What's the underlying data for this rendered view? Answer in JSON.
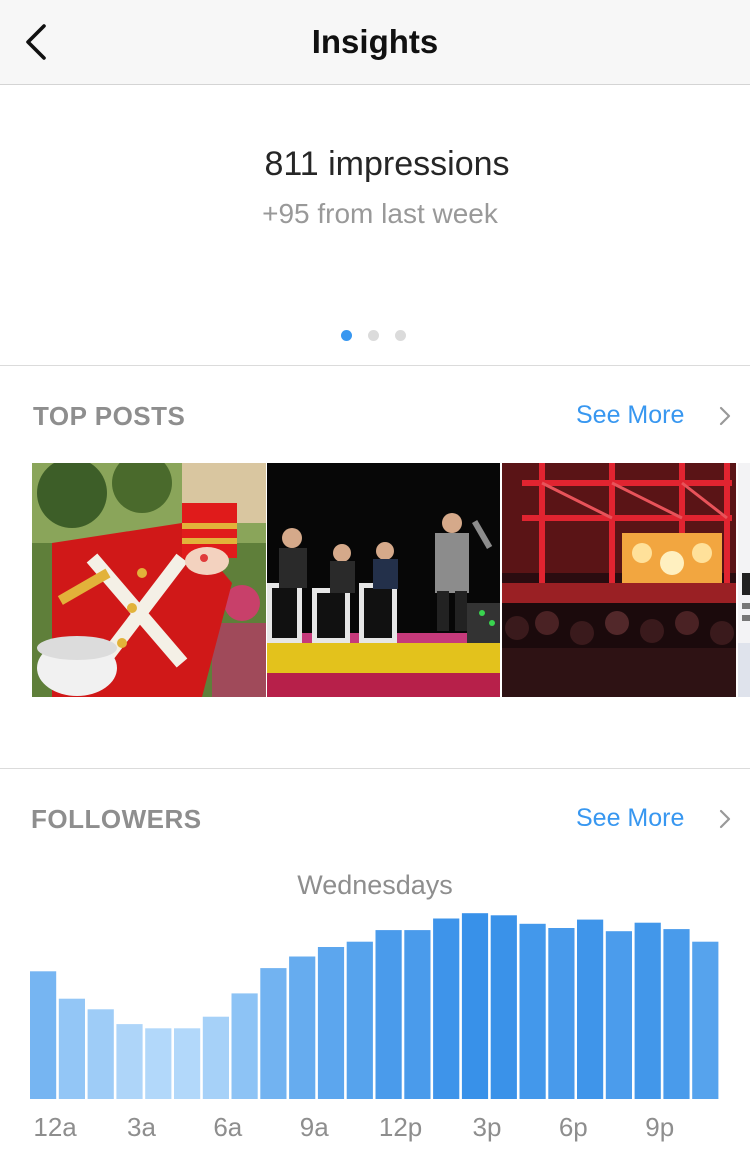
{
  "header": {
    "title": "Insights",
    "back_icon": "chevron-left-icon"
  },
  "summary": {
    "impressions": "811 impressions",
    "delta": "+95 from last week",
    "pager": {
      "pages": 3,
      "active": 0
    }
  },
  "top_posts": {
    "title": "TOP POSTS",
    "see_more": "See More",
    "posts": [
      {
        "name": "toy-soldier-drummer"
      },
      {
        "name": "band-on-stage"
      },
      {
        "name": "concert-crowd-red-lights"
      },
      {
        "name": "text-post-partial"
      }
    ]
  },
  "followers": {
    "title": "FOLLOWERS",
    "see_more": "See More"
  },
  "colors": {
    "accent": "#3897f0",
    "muted": "#8e8e8e",
    "divider": "#dbdbdb"
  },
  "chart_data": {
    "type": "bar",
    "title": "Wednesdays",
    "categories": [
      "12a",
      "1a",
      "2a",
      "3a",
      "4a",
      "5a",
      "6a",
      "7a",
      "8a",
      "9a",
      "10a",
      "11a",
      "12p",
      "1p",
      "2p",
      "3p",
      "4p",
      "5p",
      "6p",
      "7p",
      "8p",
      "9p",
      "10p",
      "11p"
    ],
    "tick_labels": [
      "12a",
      "3a",
      "6a",
      "9a",
      "12p",
      "3p",
      "6p",
      "9p"
    ],
    "values": [
      121,
      95,
      85,
      71,
      67,
      67,
      78,
      100,
      124,
      135,
      144,
      149,
      160,
      160,
      171,
      176,
      174,
      166,
      162,
      170,
      159,
      167,
      161,
      149
    ],
    "ylim": [
      0,
      180
    ],
    "xlabel": "",
    "ylabel": "",
    "grid": false,
    "legend": "none"
  }
}
